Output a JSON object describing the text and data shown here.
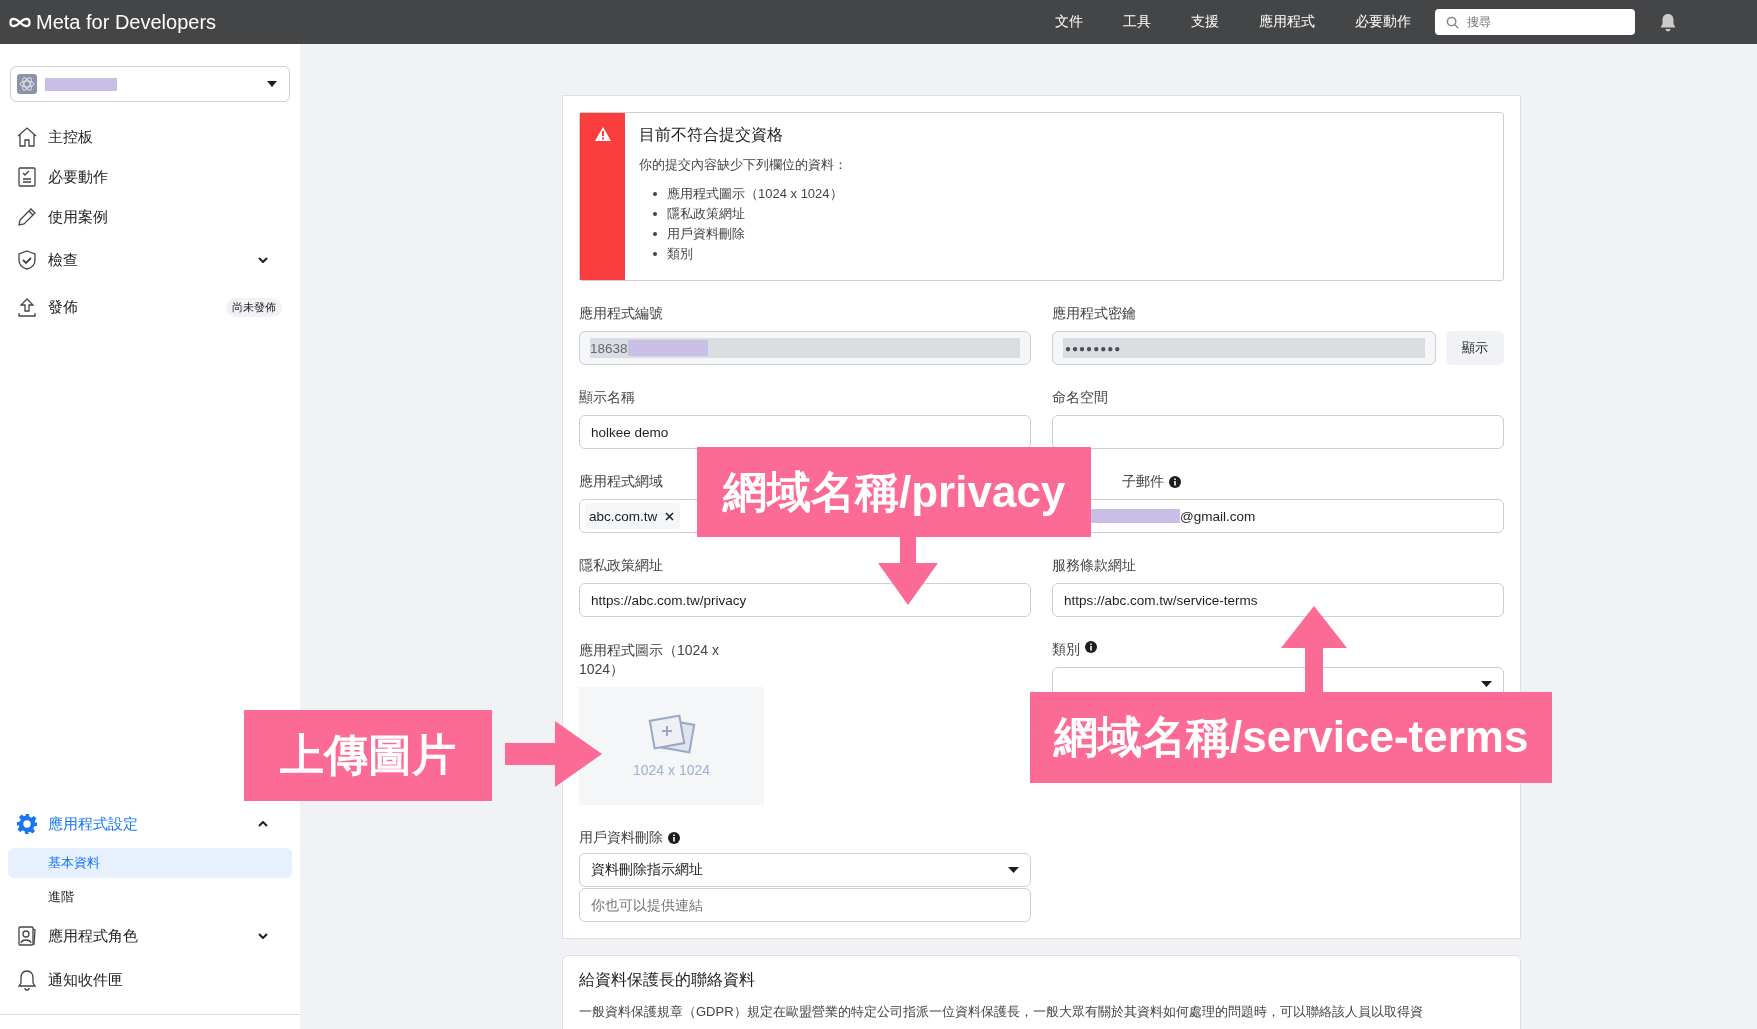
{
  "topbar": {
    "logo": "Meta for Developers",
    "nav": [
      "文件",
      "工具",
      "支援",
      "應用程式",
      "必要動作"
    ],
    "search": {
      "placeholder": "搜尋"
    }
  },
  "sidebar": {
    "app_selector": {
      "redacted": true
    },
    "items": [
      {
        "label": "主控板"
      },
      {
        "label": "必要動作"
      },
      {
        "label": "使用案例"
      },
      {
        "label": "檢查",
        "expanded": false
      },
      {
        "label": "發佈",
        "badge": "尚未發佈"
      }
    ],
    "bottom_items": [
      {
        "label": "應用程式設定",
        "expanded": true,
        "active": true,
        "children": [
          {
            "label": "基本資料",
            "selected": true
          },
          {
            "label": "進階",
            "selected": false
          }
        ]
      },
      {
        "label": "應用程式角色",
        "expanded": false,
        "active": false
      },
      {
        "label": "通知收件匣",
        "active": false
      }
    ]
  },
  "alert": {
    "title": "目前不符合提交資格",
    "message": "你的提交內容缺少下列欄位的資料：",
    "missing": [
      "應用程式圖示（1024 x 1024）",
      "隱私政策網址",
      "用戶資料刪除",
      "類別"
    ]
  },
  "form_rows": [
    [
      {
        "label": "應用程式編號",
        "kind": "readonly",
        "value": "18638",
        "redacted": true
      },
      {
        "label": "應用程式密鑰",
        "kind": "secret",
        "value": "●●●●●●●●",
        "button": "顯示"
      }
    ],
    [
      {
        "label": "顯示名稱",
        "kind": "text",
        "value": "holkee demo"
      },
      {
        "label": "命名空間",
        "kind": "text"
      }
    ],
    [
      {
        "label": "應用程式網域",
        "kind": "tags",
        "tags": [
          "abc.com.tw"
        ]
      },
      {
        "label": "子郵件",
        "info": true,
        "kind": "text",
        "value": "@gmail.com",
        "redacted": true
      }
    ],
    [
      {
        "label": "隱私政策網址",
        "kind": "text",
        "value": "https://abc.com.tw/privacy"
      },
      {
        "label": "服務條款網址",
        "kind": "text",
        "value": "https://abc.com.tw/service-terms"
      }
    ],
    [
      {
        "label": "應用程式圖示（1024 x 1024）",
        "kind": "image",
        "caption": "1024 x 1024"
      },
      {
        "label": "類別",
        "info": true,
        "kind": "select"
      }
    ],
    [
      {
        "label": "用戶資料刪除",
        "info": true,
        "kind": "select",
        "value": "資料刪除指示網址",
        "placeholder": "你也可以提供連結"
      }
    ]
  ],
  "contact_card": {
    "title": "給資料保護長的聯絡資料",
    "text": "一般資料保護規章（GDPR）規定在歐盟營業的特定公司指派一位資料保護長，一般大眾有關於其資料如何處理的問題時，可以聯絡該人員以取得資"
  },
  "annotations": [
    {
      "text": "網域名稱/privacy",
      "kind": "down"
    },
    {
      "text": "網域名稱/service-terms",
      "kind": "up"
    },
    {
      "text": "上傳圖片",
      "kind": "right"
    }
  ]
}
